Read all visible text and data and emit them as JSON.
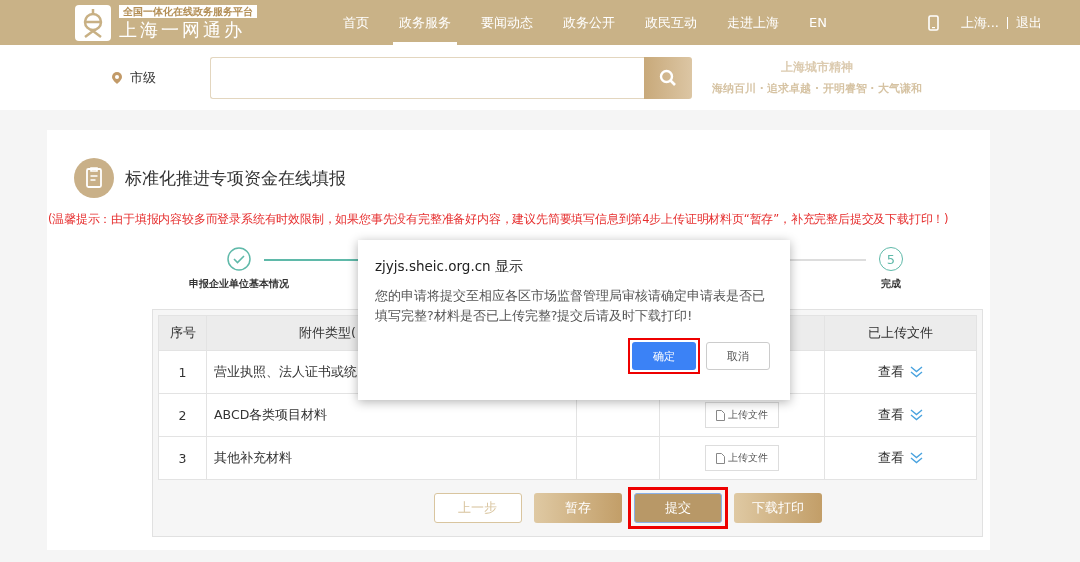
{
  "header": {
    "logo": {
      "subtitle": "全国一体化在线政务服务平台",
      "title": "上海一网通办"
    },
    "nav": [
      {
        "label": "首页",
        "selected": false
      },
      {
        "label": "政务服务",
        "selected": true
      },
      {
        "label": "要闻动态",
        "selected": false
      },
      {
        "label": "政务公开",
        "selected": false
      },
      {
        "label": "政民互动",
        "selected": false
      },
      {
        "label": "走进上海",
        "selected": false
      },
      {
        "label": "EN",
        "selected": false
      }
    ],
    "user": "上海...",
    "logout": "退出"
  },
  "searchbar": {
    "location": "市级",
    "slogan_title": "上海城市精神",
    "slogan_text": "海纳百川 · 追求卓越 · 开明睿智 · 大气谦和"
  },
  "form": {
    "title": "标准化推进专项资金在线填报",
    "notice": "(温馨提示：由于填报内容较多而登录系统有时效限制，如果您事先没有完整准备好内容，建议先简要填写信息到第4步上传证明材料页“暂存”，补充完整后提交及下载打印！)",
    "steps": [
      {
        "done": true,
        "label": "申报企业单位基本情况"
      },
      {
        "done": false,
        "number": "5",
        "label": "完成"
      }
    ],
    "table": {
      "columns": [
        {
          "label": "序号"
        },
        {
          "label": "附件类型("
        },
        {},
        {},
        {
          "label": "已上传文件"
        }
      ],
      "rows": [
        {
          "index": "1",
          "type": "营业执照、法人证书或统",
          "view": "查看"
        },
        {
          "index": "2",
          "type": "ABCD各类项目材料",
          "upload": "上传文件",
          "view": "查看"
        },
        {
          "index": "3",
          "type": "其他补充材料",
          "upload": "上传文件",
          "view": "查看"
        }
      ]
    },
    "buttons": [
      {
        "label": "上一步",
        "kind": "outline",
        "highlighted": false
      },
      {
        "label": "暂存",
        "kind": "gold",
        "highlighted": false
      },
      {
        "label": "提交",
        "kind": "dark",
        "highlighted": true
      },
      {
        "label": "下载打印",
        "kind": "gold",
        "highlighted": false
      }
    ]
  },
  "dialog": {
    "title": "zjyjs.sheic.org.cn 显示",
    "message": "您的申请将提交至相应各区市场监督管理局审核请确定申请表是否已填写完整?材料是否已上传完整?提交后请及时下载打印!",
    "buttons": [
      {
        "label": "确定",
        "kind": "primary",
        "highlighted": true
      },
      {
        "label": "取消",
        "kind": "plain",
        "highlighted": false
      }
    ]
  }
}
